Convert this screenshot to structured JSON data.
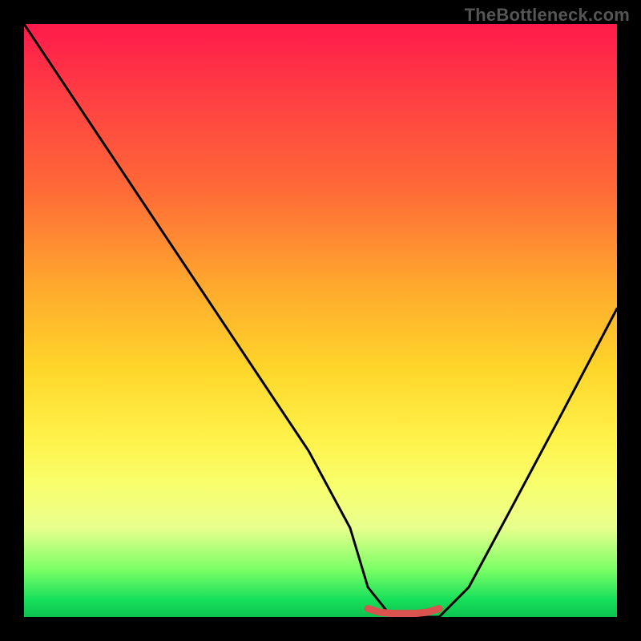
{
  "watermark": "TheBottleneck.com",
  "chart_data": {
    "type": "line",
    "title": "",
    "xlabel": "",
    "ylabel": "",
    "xlim": [
      0,
      100
    ],
    "ylim": [
      0,
      100
    ],
    "grid": false,
    "legend": false,
    "series": [
      {
        "name": "bottleneck-curve",
        "x": [
          0,
          8,
          16,
          24,
          32,
          40,
          48,
          55,
          58,
          62,
          66,
          70,
          75,
          82,
          90,
          100
        ],
        "values": [
          100,
          88,
          76,
          64,
          52,
          40,
          28,
          15,
          5,
          0,
          0,
          0,
          5,
          18,
          33,
          52
        ],
        "color": "#000000"
      },
      {
        "name": "flat-minimum-highlight",
        "x": [
          58,
          60,
          62,
          64,
          66,
          68,
          70
        ],
        "values": [
          1.4,
          0.8,
          0.6,
          0.6,
          0.6,
          0.8,
          1.4
        ],
        "color": "#d9534f"
      }
    ],
    "gradient_stops": [
      {
        "pos": 0,
        "color": "#ff1a4b"
      },
      {
        "pos": 12,
        "color": "#ff3e43"
      },
      {
        "pos": 28,
        "color": "#ff6a37"
      },
      {
        "pos": 44,
        "color": "#ffa82d"
      },
      {
        "pos": 58,
        "color": "#ffd52a"
      },
      {
        "pos": 70,
        "color": "#fff24a"
      },
      {
        "pos": 78,
        "color": "#f8ff6e"
      },
      {
        "pos": 85,
        "color": "#e8ff8e"
      },
      {
        "pos": 92,
        "color": "#7bff66"
      },
      {
        "pos": 97,
        "color": "#18e05a"
      },
      {
        "pos": 100,
        "color": "#0bc24f"
      }
    ]
  }
}
